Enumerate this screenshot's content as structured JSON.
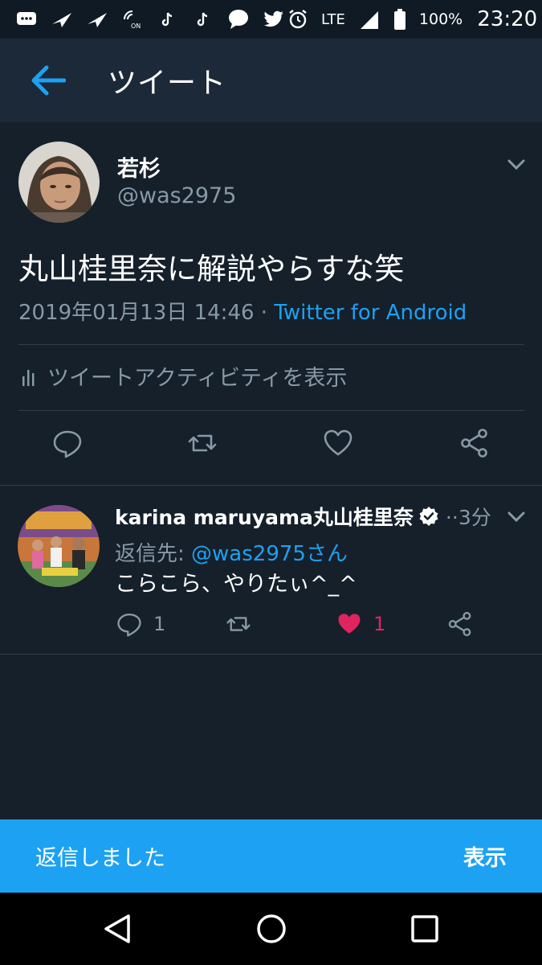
{
  "status_bar": {
    "network": "LTE",
    "battery": "100%",
    "time": "23:20",
    "left_icons": [
      "message-icon",
      "paper-plane-icon",
      "paper-plane-icon",
      "nfc-on-icon",
      "tiktok-icon",
      "tiktok-icon",
      "chat-bubble-icon",
      "twitter-bird-icon"
    ],
    "right_icons": [
      "alarm-icon",
      "signal-icon",
      "battery-icon"
    ],
    "nfc_label": "ON"
  },
  "header": {
    "title": "ツイート"
  },
  "tweet": {
    "author_name": "若杉",
    "author_handle": "@was2975",
    "text": "丸山桂里奈に解説やらすな笑",
    "timestamp": "2019年01月13日 14:46",
    "separator": " · ",
    "source": "Twitter for Android",
    "activity_label": "ツイートアクティビティを表示"
  },
  "reply": {
    "author_name": "karina maruyama丸山桂里奈",
    "time_sep": "··",
    "time": "3分",
    "reply_to_label": "返信先: ",
    "reply_to_mention": "@was2975さん",
    "text": "こらこら、やりたぃ^_^",
    "reply_count": "1",
    "like_count": "1",
    "liked": true
  },
  "snackbar": {
    "message": "返信しました",
    "action": "表示"
  },
  "colors": {
    "background": "#15202b",
    "header": "#1c2938",
    "accent": "#1da1f2",
    "muted": "#8899a6",
    "like": "#e0245e"
  }
}
